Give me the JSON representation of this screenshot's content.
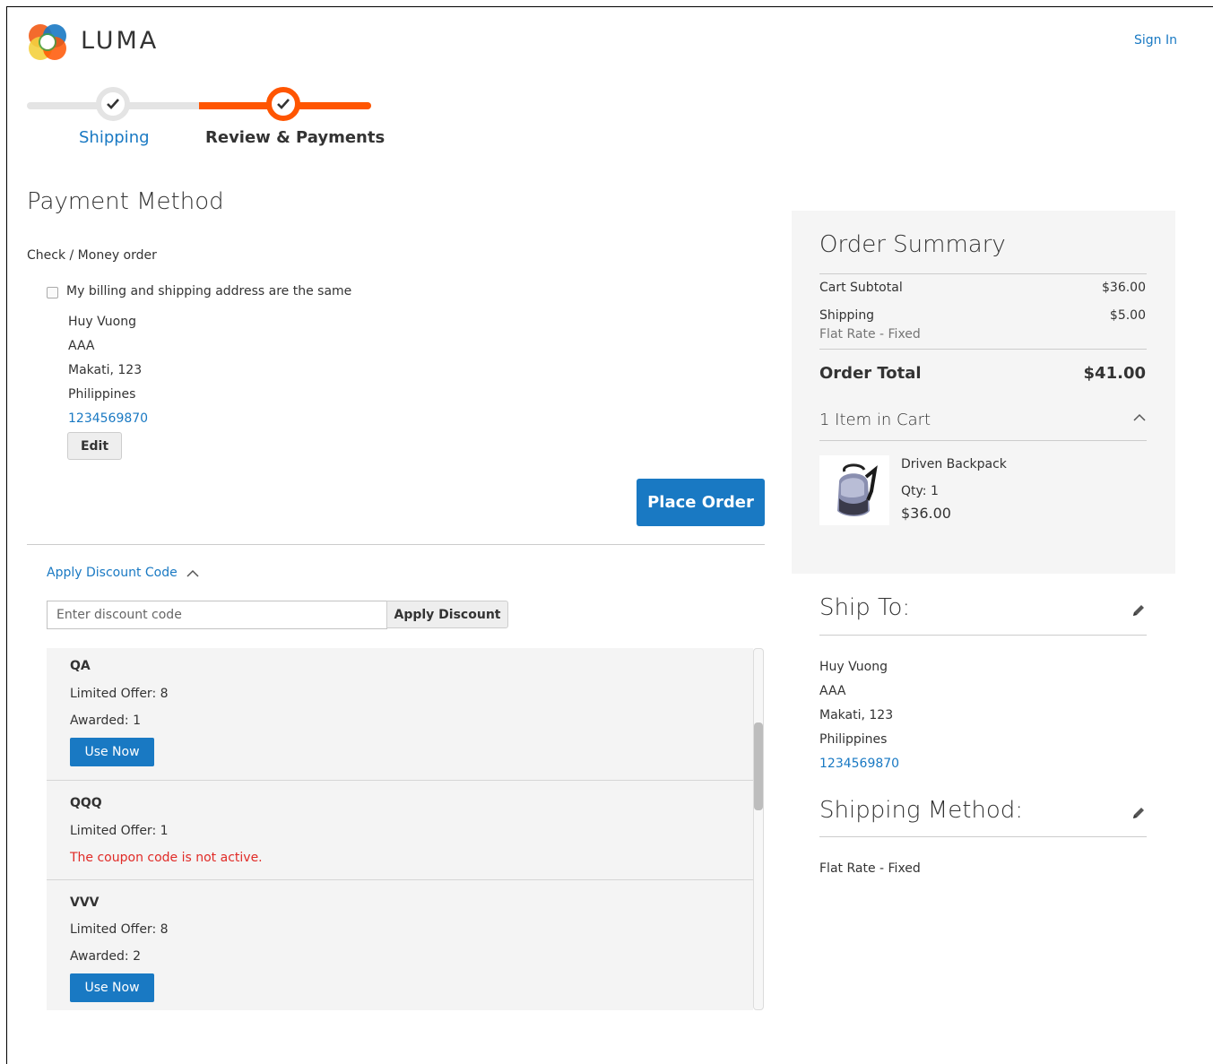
{
  "header": {
    "logo_text": "LUMA",
    "sign_in": "Sign In"
  },
  "progress": {
    "steps": [
      {
        "label": "Shipping",
        "state": "complete"
      },
      {
        "label": "Review & Payments",
        "state": "active"
      }
    ],
    "colors": {
      "active": "#ff5501",
      "inactive": "#e4e4e4"
    }
  },
  "payment": {
    "heading": "Payment Method",
    "method": "Check / Money order",
    "same_address_label": "My billing and shipping address are the same",
    "same_address_checked": false,
    "address": {
      "name": "Huy Vuong",
      "street": "AAA",
      "city": "Makati, 123",
      "country": "Philippines",
      "phone": "1234569870"
    },
    "edit_label": "Edit",
    "place_order_label": "Place Order"
  },
  "discount": {
    "toggle_label": "Apply Discount Code",
    "input_placeholder": "Enter discount code",
    "apply_label": "Apply Discount",
    "coupons": [
      {
        "code": "QA",
        "limited": "Limited Offer: 8",
        "awarded": "Awarded: 1",
        "button": "Use Now"
      },
      {
        "code": "QQQ",
        "limited": "Limited Offer: 1",
        "error": "The coupon code is not active."
      },
      {
        "code": "VVV",
        "limited": "Limited Offer: 8",
        "awarded": "Awarded: 2",
        "button": "Use Now"
      }
    ]
  },
  "summary": {
    "title": "Order Summary",
    "subtotal_label": "Cart Subtotal",
    "subtotal_value": "$36.00",
    "shipping_label": "Shipping",
    "shipping_method": "Flat Rate - Fixed",
    "shipping_value": "$5.00",
    "total_label": "Order Total",
    "total_value": "$41.00",
    "items_label": "1 Item in Cart",
    "item": {
      "name": "Driven Backpack",
      "qty": "Qty: 1",
      "price": "$36.00"
    }
  },
  "ship_to": {
    "title": "Ship To:",
    "name": "Huy Vuong",
    "street": "AAA",
    "city": "Makati, 123",
    "country": "Philippines",
    "phone": "1234569870"
  },
  "shipping_method": {
    "title": "Shipping Method:",
    "value": "Flat Rate - Fixed"
  }
}
